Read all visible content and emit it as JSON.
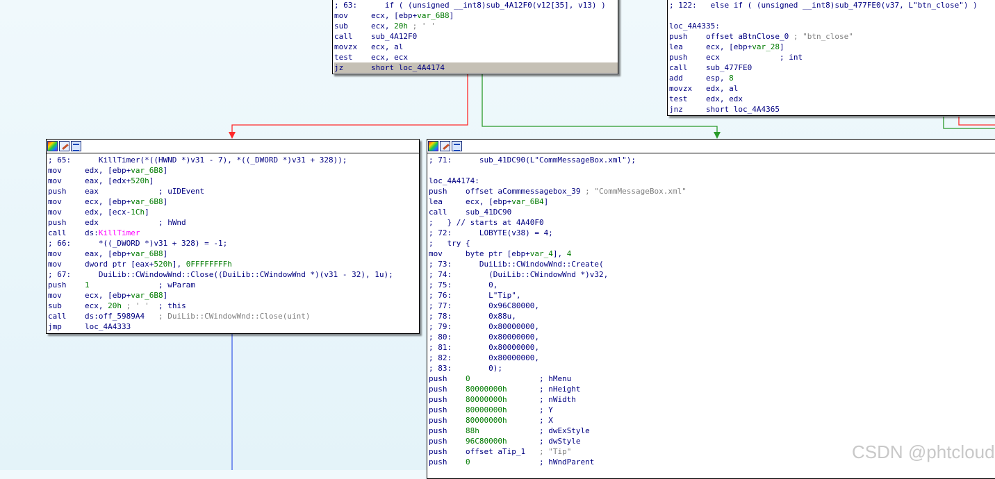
{
  "nodes": {
    "top_left": {
      "lines": [
        [
          [
            "src",
            "; 63:      if ( (unsigned __int8)sub_4A12F0(v12[35], v13) )"
          ]
        ],
        [
          [
            "mn",
            "mov     "
          ],
          [
            "op",
            "ecx, [ebp+"
          ],
          [
            "var",
            "var_6B8"
          ],
          [
            "op",
            "]"
          ]
        ],
        [
          [
            "mn",
            "sub     "
          ],
          [
            "op",
            "ecx, "
          ],
          [
            "num",
            "20h"
          ],
          [
            "cmt",
            " ; ' '"
          ]
        ],
        [
          [
            "mn",
            "call    "
          ],
          [
            "op",
            "sub_4A12F0"
          ]
        ],
        [
          [
            "mn",
            "movzx   "
          ],
          [
            "op",
            "ecx, al"
          ]
        ],
        [
          [
            "mn",
            "test    "
          ],
          [
            "op",
            "ecx, ecx"
          ]
        ],
        [
          [
            "mn",
            "jz      "
          ],
          [
            "op",
            "short loc_4A4174"
          ]
        ]
      ]
    },
    "top_right": {
      "lines": [
        [
          [
            "src",
            "; 122:   else if ( (unsigned __int8)sub_477FE0(v37, L\"btn_close\") )"
          ]
        ],
        [
          [
            "lbl",
            ""
          ]
        ],
        [
          [
            "lbl",
            "loc_4A4335:"
          ]
        ],
        [
          [
            "mn",
            "push    "
          ],
          [
            "op",
            "offset aBtnClose_0 "
          ],
          [
            "cmt",
            "; \"btn_close\""
          ]
        ],
        [
          [
            "mn",
            "lea     "
          ],
          [
            "op",
            "ecx, [ebp+"
          ],
          [
            "var",
            "var_28"
          ],
          [
            "op",
            "]"
          ]
        ],
        [
          [
            "mn",
            "push    "
          ],
          [
            "op",
            "ecx             ; int"
          ]
        ],
        [
          [
            "mn",
            "call    "
          ],
          [
            "op",
            "sub_477FE0"
          ]
        ],
        [
          [
            "mn",
            "add     "
          ],
          [
            "op",
            "esp, "
          ],
          [
            "num",
            "8"
          ]
        ],
        [
          [
            "mn",
            "movzx   "
          ],
          [
            "op",
            "edx, al"
          ]
        ],
        [
          [
            "mn",
            "test    "
          ],
          [
            "op",
            "edx, edx"
          ]
        ],
        [
          [
            "mn",
            "jnz     "
          ],
          [
            "op",
            "short loc_4A4365"
          ]
        ]
      ]
    },
    "mid_left": {
      "lines": [
        [
          [
            "src",
            "; 65:      KillTimer(*((HWND *)v31 - 7), *((_DWORD *)v31 + 328));"
          ]
        ],
        [
          [
            "mn",
            "mov     "
          ],
          [
            "op",
            "edx, [ebp+"
          ],
          [
            "var",
            "var_6B8"
          ],
          [
            "op",
            "]"
          ]
        ],
        [
          [
            "mn",
            "mov     "
          ],
          [
            "op",
            "eax, [edx+"
          ],
          [
            "num",
            "520h"
          ],
          [
            "op",
            "]"
          ]
        ],
        [
          [
            "mn",
            "push    "
          ],
          [
            "op",
            "eax             ; uIDEvent"
          ]
        ],
        [
          [
            "mn",
            "mov     "
          ],
          [
            "op",
            "ecx, [ebp+"
          ],
          [
            "var",
            "var_6B8"
          ],
          [
            "op",
            "]"
          ]
        ],
        [
          [
            "mn",
            "mov     "
          ],
          [
            "op",
            "edx, [ecx-"
          ],
          [
            "num",
            "1Ch"
          ],
          [
            "op",
            "]"
          ]
        ],
        [
          [
            "mn",
            "push    "
          ],
          [
            "op",
            "edx             ; hWnd"
          ]
        ],
        [
          [
            "mn",
            "call    "
          ],
          [
            "op",
            "ds:"
          ],
          [
            "fn",
            "KillTimer"
          ]
        ],
        [
          [
            "src",
            "; 66:      *((_DWORD *)v31 + 328) = -1;"
          ]
        ],
        [
          [
            "mn",
            "mov     "
          ],
          [
            "op",
            "eax, [ebp+"
          ],
          [
            "var",
            "var_6B8"
          ],
          [
            "op",
            "]"
          ]
        ],
        [
          [
            "mn",
            "mov     "
          ],
          [
            "op",
            "dword ptr [eax+"
          ],
          [
            "num",
            "520h"
          ],
          [
            "op",
            "], "
          ],
          [
            "num",
            "0FFFFFFFFh"
          ]
        ],
        [
          [
            "src",
            "; 67:      DuiLib::CWindowWnd::Close((DuiLib::CWindowWnd *)(v31 - 32), 1u);"
          ]
        ],
        [
          [
            "mn",
            "push    "
          ],
          [
            "num",
            "1"
          ],
          [
            "op",
            "               ; wParam"
          ]
        ],
        [
          [
            "mn",
            "mov     "
          ],
          [
            "op",
            "ecx, [ebp+"
          ],
          [
            "var",
            "var_6B8"
          ],
          [
            "op",
            "]"
          ]
        ],
        [
          [
            "mn",
            "sub     "
          ],
          [
            "op",
            "ecx, "
          ],
          [
            "num",
            "20h"
          ],
          [
            "cmt",
            " ; ' '"
          ],
          [
            "op",
            "  ; this"
          ]
        ],
        [
          [
            "mn",
            "call    "
          ],
          [
            "op",
            "ds:off_5989A4   "
          ],
          [
            "cmt",
            "; DuiLib::CWindowWnd::Close(uint)"
          ]
        ],
        [
          [
            "mn",
            "jmp     "
          ],
          [
            "op",
            "loc_4A4333"
          ]
        ]
      ]
    },
    "mid_right": {
      "lines": [
        [
          [
            "src",
            "; 71:      sub_41DC90(L\"CommMessageBox.xml\");"
          ]
        ],
        [
          [
            "lbl",
            ""
          ]
        ],
        [
          [
            "lbl",
            "loc_4A4174:"
          ]
        ],
        [
          [
            "mn",
            "push    "
          ],
          [
            "op",
            "offset aCommmessagebox_39 "
          ],
          [
            "cmt",
            "; \"CommMessageBox.xml\""
          ]
        ],
        [
          [
            "mn",
            "lea     "
          ],
          [
            "op",
            "ecx, [ebp+"
          ],
          [
            "var",
            "var_6B4"
          ],
          [
            "op",
            "]"
          ]
        ],
        [
          [
            "mn",
            "call    "
          ],
          [
            "op",
            "sub_41DC90"
          ]
        ],
        [
          [
            "src",
            ";   } // starts at 4A40F0"
          ]
        ],
        [
          [
            "src",
            "; 72:      LOBYTE(v38) = 4;"
          ]
        ],
        [
          [
            "src",
            ";   try {"
          ]
        ],
        [
          [
            "mn",
            "mov     "
          ],
          [
            "op",
            "byte ptr [ebp+"
          ],
          [
            "var",
            "var_4"
          ],
          [
            "op",
            "], "
          ],
          [
            "num",
            "4"
          ]
        ],
        [
          [
            "src",
            "; 73:      DuiLib::CWindowWnd::Create("
          ]
        ],
        [
          [
            "src",
            "; 74:        (DuiLib::CWindowWnd *)v32,"
          ]
        ],
        [
          [
            "src",
            "; 75:        0,"
          ]
        ],
        [
          [
            "src",
            "; 76:        L\"Tip\","
          ]
        ],
        [
          [
            "src",
            "; 77:        0x96C80000,"
          ]
        ],
        [
          [
            "src",
            "; 78:        0x88u,"
          ]
        ],
        [
          [
            "src",
            "; 79:        0x80000000,"
          ]
        ],
        [
          [
            "src",
            "; 80:        0x80000000,"
          ]
        ],
        [
          [
            "src",
            "; 81:        0x80000000,"
          ]
        ],
        [
          [
            "src",
            "; 82:        0x80000000,"
          ]
        ],
        [
          [
            "src",
            "; 83:        0);"
          ]
        ],
        [
          [
            "mn",
            "push    "
          ],
          [
            "num",
            "0"
          ],
          [
            "op",
            "               ; hMenu"
          ]
        ],
        [
          [
            "mn",
            "push    "
          ],
          [
            "num",
            "80000000h"
          ],
          [
            "op",
            "       ; nHeight"
          ]
        ],
        [
          [
            "mn",
            "push    "
          ],
          [
            "num",
            "80000000h"
          ],
          [
            "op",
            "       ; nWidth"
          ]
        ],
        [
          [
            "mn",
            "push    "
          ],
          [
            "num",
            "80000000h"
          ],
          [
            "op",
            "       ; Y"
          ]
        ],
        [
          [
            "mn",
            "push    "
          ],
          [
            "num",
            "80000000h"
          ],
          [
            "op",
            "       ; X"
          ]
        ],
        [
          [
            "mn",
            "push    "
          ],
          [
            "num",
            "88h"
          ],
          [
            "op",
            "             ; dwExStyle"
          ]
        ],
        [
          [
            "mn",
            "push    "
          ],
          [
            "num",
            "96C80000h"
          ],
          [
            "op",
            "       ; dwStyle"
          ]
        ],
        [
          [
            "mn",
            "push    "
          ],
          [
            "op",
            "offset aTip_1   "
          ],
          [
            "cmt",
            "; \"Tip\""
          ]
        ],
        [
          [
            "mn",
            "push    "
          ],
          [
            "num",
            "0"
          ],
          [
            "op",
            "               ; hWndParent"
          ]
        ]
      ]
    }
  },
  "watermark": "CSDN @phtcloud",
  "colors": {
    "edge_true": "#2a9a2a",
    "edge_false": "#ff2a2a",
    "edge_jump": "#4060e8"
  }
}
